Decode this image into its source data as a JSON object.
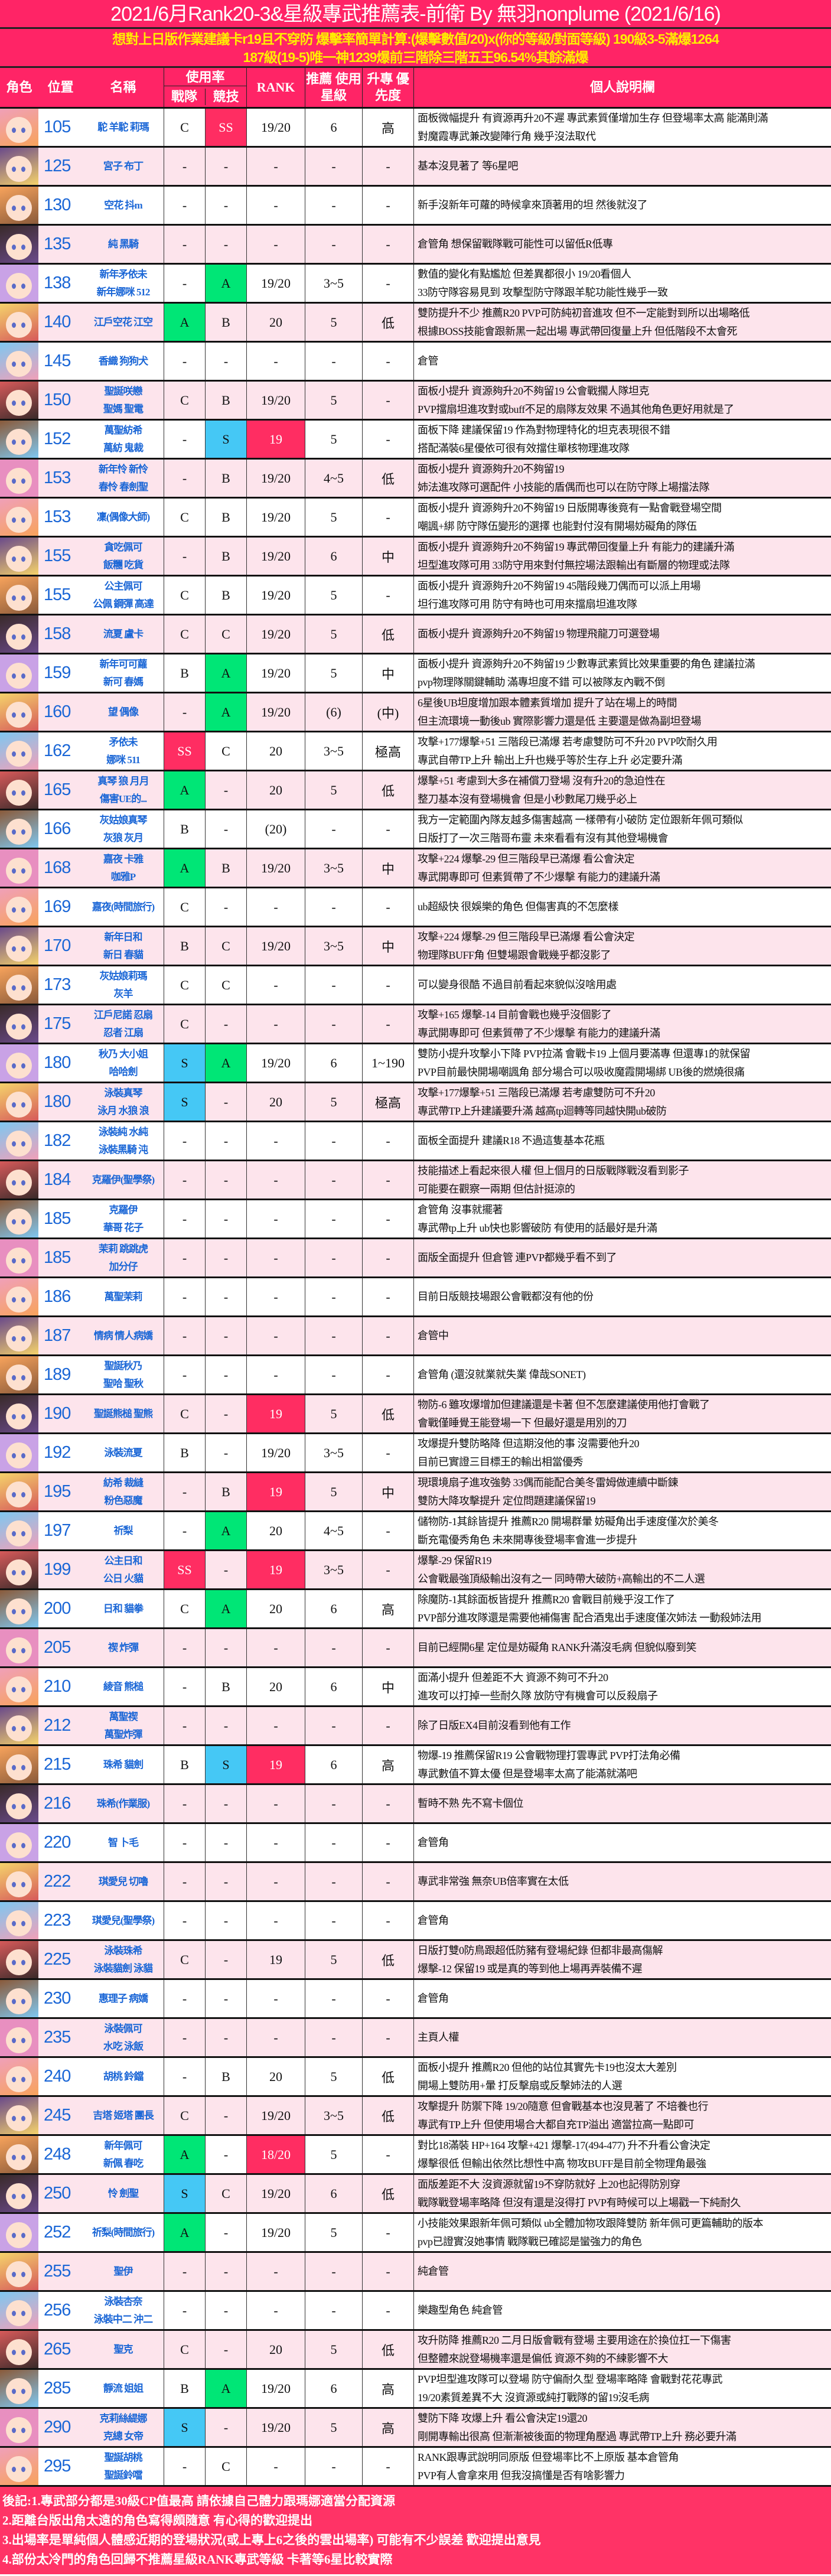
{
  "header": {
    "title": "2021/6月Rank20-3&星級專武推薦表-前衛 By 無羽nonplume (2021/6/16)",
    "subtitle_lines": [
      "想對上日版作業建議卡r19且不穿防 爆擊率簡單計算:(爆擊數值/20)x(你的等級/對面等級) 190級3-5滿爆1264",
      "187級(19-5)唯一神1239爆前三階除三階五王96.54%其餘滿爆"
    ]
  },
  "columns": {
    "character": "角色",
    "position": "位置",
    "name": "名稱",
    "usage": "使用率",
    "team": "戰隊",
    "arena": "競技",
    "rank": "RANK",
    "star": "推薦 使用星級",
    "priority": "升專 優先度",
    "notes": "個人說明欄"
  },
  "colors": {
    "header_bg": "#ff2466",
    "subtitle_text": "#ffee00",
    "row_alt": "#fde4ec",
    "SS": "#ff2d62",
    "S": "#45c8f5",
    "A": "#00e676",
    "rank_highlight": "#ff2d62",
    "name_text": "#1a66d6"
  },
  "rows": [
    {
      "no": "105",
      "name": [
        "駝 羊駝 莉瑪"
      ],
      "team": "C",
      "arena": "SS",
      "rank": "19/20",
      "star": "6",
      "priority": "高",
      "notes": [
        "面板微幅提升 有資源再升20不遲 專武素質僅增加生存 但登場率太高 能滿則滿",
        "對魔霞專武兼改變陣行角 幾乎沒法取代"
      ]
    },
    {
      "no": "125",
      "name": [
        "宮子 布丁"
      ],
      "team": "-",
      "arena": "-",
      "rank": "-",
      "star": "-",
      "priority": "-",
      "notes": [
        "基本沒見著了 等6星吧"
      ]
    },
    {
      "no": "130",
      "name": [
        "空花 抖m"
      ],
      "team": "-",
      "arena": "-",
      "rank": "-",
      "star": "-",
      "priority": "-",
      "notes": [
        "新手沒新年可蘿的時候拿來頂著用的坦 然後就沒了"
      ]
    },
    {
      "no": "135",
      "name": [
        "純 黑騎"
      ],
      "team": "-",
      "arena": "-",
      "rank": "-",
      "star": "-",
      "priority": "-",
      "notes": [
        "倉管角 想保留戰隊戰可能性可以留低R低專"
      ]
    },
    {
      "no": "138",
      "name": [
        "新年矛依未",
        "新年娜咪 512"
      ],
      "team": "-",
      "arena": "A",
      "rank": "19/20",
      "star": "3~5",
      "priority": "-",
      "notes": [
        "數值的變化有點尷尬 但差異都很小 19/20看個人",
        "33防守隊容易見到 攻擊型防守隊跟羊駝功能性幾乎一致"
      ]
    },
    {
      "no": "140",
      "name": [
        "江戶空花 江空"
      ],
      "team": "A",
      "arena": "B",
      "rank": "20",
      "star": "5",
      "priority": "低",
      "notes": [
        "雙防提升不少 推薦R20 PVP可防純初音進攻 但不一定能對到所以出場略低",
        "根據BOSS技能會跟新黑一起出場 專武帶回復量上升 但低階段不太會死"
      ]
    },
    {
      "no": "145",
      "name": [
        "香織 狗狗犬"
      ],
      "team": "-",
      "arena": "-",
      "rank": "-",
      "star": "-",
      "priority": "-",
      "notes": [
        "倉管"
      ]
    },
    {
      "no": "150",
      "name": [
        "聖誕咲戀",
        "聖媽 聖電"
      ],
      "team": "C",
      "arena": "B",
      "rank": "19/20",
      "star": "5",
      "priority": "-",
      "notes": [
        "面板小提升 資源夠升20不夠留19 公會戰擱人隊坦克",
        "PVP擋扇坦進攻對或buff不足的扇隊友效果 不過其他角色更好用就是了"
      ]
    },
    {
      "no": "152",
      "name": [
        "萬聖紡希",
        "萬紡 鬼裁"
      ],
      "team": "-",
      "arena": "S",
      "rank": "19",
      "rank_hl": true,
      "star": "5",
      "priority": "-",
      "notes": [
        "面板下降 建議保留19 作為對物理特化的坦克表現很不錯",
        "搭配滿裝6星優依可很有效擋住單核物理進攻隊"
      ]
    },
    {
      "no": "153",
      "name": [
        "新年怜 新怜",
        "春怜 春劍聖"
      ],
      "team": "-",
      "arena": "B",
      "rank": "19/20",
      "star": "4~5",
      "priority": "低",
      "notes": [
        "面板小提升 資源夠升20不夠留19",
        "姉法進攻隊可選配件 小技能的盾偶而也可以在防守隊上場擋法隊"
      ]
    },
    {
      "no": "153",
      "name": [
        "凜(偶像大師)"
      ],
      "team": "C",
      "arena": "B",
      "rank": "19/20",
      "star": "5",
      "priority": "-",
      "notes": [
        "面板小提升 資源夠升20不夠留19 日版開專後竟有一點會戰登場空間",
        "嘲諷+綁 防守隊伍變形的選擇 也能對付沒有開場妨礙角的隊伍"
      ]
    },
    {
      "no": "155",
      "name": [
        "貪吃佩可",
        "飯糰 吃貨"
      ],
      "team": "-",
      "arena": "B",
      "rank": "19/20",
      "star": "6",
      "priority": "中",
      "notes": [
        "面板小提升 資源夠升20不夠留19 專武帶回復量上升 有能力的建議升滿",
        "坦型進攻隊可用 33防守用來對付無控場法跟輸出有斷層的物理或法隊"
      ]
    },
    {
      "no": "155",
      "name": [
        "公主佩可",
        "公佩 鋼彈 高達"
      ],
      "team": "C",
      "arena": "B",
      "rank": "19/20",
      "star": "5",
      "priority": "-",
      "notes": [
        "面板小提升 資源夠升20不夠留19 45階段幾刀偶而可以派上用場",
        "坦行進攻隊可用 防守有時也可用來擋扇坦進攻隊"
      ]
    },
    {
      "no": "158",
      "name": [
        "流夏 盧卡"
      ],
      "team": "C",
      "arena": "C",
      "rank": "19/20",
      "star": "5",
      "priority": "低",
      "notes": [
        "面板小提升 資源夠升20不夠留19 物理飛龍刀可選登場"
      ]
    },
    {
      "no": "159",
      "name": [
        "新年可可蘿",
        "新可 春媽"
      ],
      "team": "B",
      "arena": "A",
      "rank": "19/20",
      "star": "5",
      "priority": "中",
      "notes": [
        "面板小提升 資源夠升20不夠留19 少數專武素質比效果重要的角色 建議拉滿",
        "pvp物理隊關鍵輔助 滿專坦度不錯 可以被隊友內戰不倒"
      ]
    },
    {
      "no": "160",
      "name": [
        "望 偶像"
      ],
      "team": "-",
      "arena": "A",
      "rank": "19/20",
      "star": "(6)",
      "priority": "(中)",
      "notes": [
        "6星後UB坦度增加跟本體素質增加 提升了站在場上的時間",
        "但主流環境一動後ub 實際影響力還是低 主要還是做為副坦登場"
      ]
    },
    {
      "no": "162",
      "name": [
        "矛依未",
        "娜咪 511"
      ],
      "team": "SS",
      "arena": "C",
      "rank": "20",
      "star": "3~5",
      "priority": "極高",
      "notes": [
        "攻擊+177爆擊+51 三階段已滿爆 若考慮雙防可不升20 PVP吹耐久用",
        "專武自帶TP上升 輸出上升也幾乎等於生存上升 必定要升滿"
      ]
    },
    {
      "no": "165",
      "name": [
        "真琴 狼 月月",
        "傷害UE的..."
      ],
      "team": "A",
      "arena": "-",
      "rank": "20",
      "star": "5",
      "priority": "低",
      "notes": [
        "爆擊+51 考慮到大多在補償刀登場 沒有升20的急迫性在",
        "整刀基本沒有登場機會 但是小秒數尾刀幾乎必上"
      ]
    },
    {
      "no": "166",
      "name": [
        "灰姑娘真琴",
        "灰狼 灰月"
      ],
      "team": "B",
      "arena": "-",
      "rank": "(20)",
      "star": "-",
      "priority": "-",
      "notes": [
        "我方一定範圍內隊友越多傷害越高 一樣帶有小破防 定位跟新年佩可類似",
        "日版打了一次三階哥布靈 未來看看有沒有其他登場機會"
      ]
    },
    {
      "no": "168",
      "name": [
        "嘉夜 卡雅",
        "咖雅P"
      ],
      "team": "A",
      "arena": "B",
      "rank": "19/20",
      "star": "3~5",
      "priority": "中",
      "notes": [
        "攻擊+224 爆擊-29 但三階段早已滿爆 看公會決定",
        "專武開專即可 但素質帶了不少爆擊 有能力的建議升滿"
      ]
    },
    {
      "no": "169",
      "name": [
        "嘉夜(時間旅行)"
      ],
      "team": "C",
      "arena": "-",
      "rank": "-",
      "star": "-",
      "priority": "-",
      "notes": [
        "ub超級快 很娛樂的角色 但傷害真的不怎麼樣"
      ]
    },
    {
      "no": "170",
      "name": [
        "新年日和",
        "新日 春貓"
      ],
      "team": "B",
      "arena": "C",
      "rank": "19/20",
      "star": "3~5",
      "priority": "中",
      "notes": [
        "攻擊+224 爆擊-29 但三階段早已滿爆 看公會決定",
        "物理隊BUFF角 但雙場跟會戰幾乎都沒影了"
      ]
    },
    {
      "no": "173",
      "name": [
        "灰姑娘莉瑪",
        "灰羊"
      ],
      "team": "C",
      "arena": "C",
      "rank": "-",
      "star": "-",
      "priority": "-",
      "notes": [
        "可以變身很酷 不過目前看起來貌似沒啥用處"
      ]
    },
    {
      "no": "175",
      "name": [
        "江戶尼諾 忍扇",
        "忍者 江扇"
      ],
      "team": "C",
      "arena": "-",
      "rank": "-",
      "star": "-",
      "priority": "-",
      "notes": [
        "攻擊+165 爆擊-14 目前會戰也幾乎沒個影了",
        "專武開專即可 但素質帶了不少爆擊 有能力的建議升滿"
      ]
    },
    {
      "no": "180",
      "name": [
        "秋乃 大小姐",
        "哈哈劍"
      ],
      "team": "S",
      "arena": "A",
      "rank": "19/20",
      "star": "6",
      "priority": "1~190",
      "notes": [
        "雙防小提升攻擊小下降 PVP拉滿 會戰卡19 上個月要滿專 但還專1的就保留",
        "PVP目前最快開場嘲諷角 部分場合可以吸收魔霞開場綁 UB後的燃燒很痛"
      ]
    },
    {
      "no": "180",
      "name": [
        "泳裝真琴",
        "泳月 水狼 浪"
      ],
      "team": "S",
      "arena": "-",
      "rank": "20",
      "star": "5",
      "priority": "極高",
      "notes": [
        "攻擊+177爆擊+51 三階段已滿爆 若考慮雙防可不升20",
        "專武帶TP上升建議要升滿 越高tp迴轉等同越快開ub破防"
      ]
    },
    {
      "no": "182",
      "name": [
        "泳裝純 水純",
        "泳裝黑騎 沌"
      ],
      "team": "-",
      "arena": "-",
      "rank": "-",
      "star": "-",
      "priority": "-",
      "notes": [
        "面板全面提升 建議R18 不過這隻基本花瓶"
      ]
    },
    {
      "no": "184",
      "name": [
        "克羅伊(聖學祭)"
      ],
      "team": "-",
      "arena": "-",
      "rank": "-",
      "star": "-",
      "priority": "-",
      "notes": [
        "技能描述上看起來很人權 但上個月的日版戰隊戰沒看到影子",
        "可能要在觀察一兩期 但估計挺涼的"
      ]
    },
    {
      "no": "185",
      "name": [
        "克羅伊",
        "華哥 花子"
      ],
      "team": "-",
      "arena": "-",
      "rank": "-",
      "star": "-",
      "priority": "-",
      "notes": [
        "倉管角 沒事就擺著",
        "專武帶tp上升 ub快也影響破防 有使用的話最好是升滿"
      ]
    },
    {
      "no": "185",
      "name": [
        "茉莉 跳跳虎",
        "加分仔"
      ],
      "team": "-",
      "arena": "-",
      "rank": "-",
      "star": "-",
      "priority": "-",
      "notes": [
        "面版全面提升 但倉管 連PVP都幾乎看不到了"
      ]
    },
    {
      "no": "186",
      "name": [
        "萬聖茉莉"
      ],
      "team": "-",
      "arena": "-",
      "rank": "-",
      "star": "-",
      "priority": "-",
      "notes": [
        "目前日版競技場跟公會戰都沒有他的份"
      ]
    },
    {
      "no": "187",
      "name": [
        "情病 情人病嬌"
      ],
      "team": "-",
      "arena": "-",
      "rank": "-",
      "star": "-",
      "priority": "-",
      "notes": [
        "倉管中"
      ]
    },
    {
      "no": "189",
      "name": [
        "聖誕秋乃",
        "聖哈 聖秋"
      ],
      "team": "-",
      "arena": "-",
      "rank": "-",
      "star": "-",
      "priority": "-",
      "notes": [
        "倉管角 (還沒就業就失業 偉哉SONET)"
      ]
    },
    {
      "no": "190",
      "name": [
        "聖誕熊槌 聖熊"
      ],
      "team": "C",
      "arena": "-",
      "rank": "19",
      "rank_hl": true,
      "star": "5",
      "priority": "低",
      "notes": [
        "物防-6 雖攻爆增加但建議還是卡著 但不怎麼建議使用他打會戰了",
        "會戰僅睡覺王能登場一下 但最好還是用別的刀"
      ]
    },
    {
      "no": "192",
      "name": [
        "泳裝流夏"
      ],
      "team": "B",
      "arena": "-",
      "rank": "19/20",
      "star": "3~5",
      "priority": "-",
      "notes": [
        "攻爆提升雙防略降 但這期沒他的事 沒需要他升20",
        "目前已實證三目標王的輸出相當優秀"
      ]
    },
    {
      "no": "195",
      "name": [
        "紡希 裁縫",
        "粉色惡魔"
      ],
      "team": "-",
      "arena": "B",
      "rank": "19",
      "rank_hl": true,
      "star": "5",
      "priority": "中",
      "notes": [
        "現環境扇子進攻強勢 33偶而能配合美冬雷姆做連續中斷鍊",
        "雙防大降攻擊提升 定位問題建議保留19"
      ]
    },
    {
      "no": "197",
      "name": [
        "祈梨"
      ],
      "team": "-",
      "arena": "A",
      "rank": "20",
      "star": "4~5",
      "priority": "-",
      "notes": [
        "儲物防-1其餘皆提升 推薦R20 開場群暈 妨礙角出手速度僅次於美冬",
        "斷充電優秀角色 未來開專後登場率會進一步提升"
      ]
    },
    {
      "no": "199",
      "name": [
        "公主日和",
        "公日 火貓"
      ],
      "team": "SS",
      "arena": "-",
      "rank": "19",
      "rank_hl": true,
      "star": "3~5",
      "priority": "-",
      "notes": [
        "爆擊-29 保留R19",
        "公會戰最強頂級輸出沒有之一 同時帶大破防+高輸出的不二人選"
      ]
    },
    {
      "no": "200",
      "name": [
        "日和 貓拳"
      ],
      "team": "C",
      "arena": "A",
      "rank": "20",
      "star": "6",
      "priority": "高",
      "notes": [
        "除魔防-1其餘面板皆提升 推薦R20 會戰目前幾乎沒工作了",
        "PVP部分進攻隊還是需要他補傷害 配合酒鬼出手速度僅次姉法 一動殺姉法用"
      ]
    },
    {
      "no": "205",
      "name": [
        "禊 炸彈"
      ],
      "team": "-",
      "arena": "-",
      "rank": "-",
      "star": "-",
      "priority": "-",
      "notes": [
        "目前已經開6星 定位是妨礙角 RANK升滿沒毛病 但貌似廢到笑"
      ]
    },
    {
      "no": "210",
      "name": [
        "綾音 熊槌"
      ],
      "team": "-",
      "arena": "B",
      "rank": "20",
      "star": "6",
      "priority": "中",
      "notes": [
        "面滿小提升 但差距不大 資源不夠可不升20",
        "進攻可以打掉一些耐久隊 放防守有機會可以反殺扇子"
      ]
    },
    {
      "no": "212",
      "name": [
        "萬聖禊",
        "萬聖炸彈"
      ],
      "team": "-",
      "arena": "-",
      "rank": "-",
      "star": "-",
      "priority": "-",
      "notes": [
        "除了日版EX4目前沒看到他有工作"
      ]
    },
    {
      "no": "215",
      "name": [
        "珠希 貓劍"
      ],
      "team": "B",
      "arena": "S",
      "rank": "19",
      "rank_hl": true,
      "star": "6",
      "priority": "高",
      "notes": [
        "物爆-19 推薦保留R19 公會戰物理打雲專武 PVP打法角必備",
        "專武數值不算太優 但是登場率太高了能滿就滿吧"
      ]
    },
    {
      "no": "216",
      "name": [
        "珠希(作業服)"
      ],
      "team": "-",
      "arena": "-",
      "rank": "-",
      "star": "-",
      "priority": "-",
      "notes": [
        "暫時不熟 先不寫卡個位"
      ]
    },
    {
      "no": "220",
      "name": [
        "智 卜毛"
      ],
      "team": "-",
      "arena": "-",
      "rank": "-",
      "star": "-",
      "priority": "-",
      "notes": [
        "倉管角"
      ]
    },
    {
      "no": "222",
      "name": [
        "琪愛兒 切嚕"
      ],
      "team": "-",
      "arena": "-",
      "rank": "-",
      "star": "-",
      "priority": "-",
      "notes": [
        "專武非常強 無奈UB倍率實在太低"
      ]
    },
    {
      "no": "223",
      "name": [
        "琪愛兒(聖學祭)"
      ],
      "team": "-",
      "arena": "-",
      "rank": "-",
      "star": "-",
      "priority": "-",
      "notes": [
        "倉管角"
      ]
    },
    {
      "no": "225",
      "name": [
        "泳裝珠希",
        "泳裝貓劍 泳貓"
      ],
      "team": "C",
      "arena": "-",
      "rank": "19",
      "star": "5",
      "priority": "低",
      "notes": [
        "日版打雙0防鳥跟超低防豬有登場紀錄 但都非最高傷解",
        "爆擊-12 保留19 或是真的等到他上場再弄裝備不遲"
      ]
    },
    {
      "no": "230",
      "name": [
        "惠理子 病嬌"
      ],
      "team": "-",
      "arena": "-",
      "rank": "-",
      "star": "-",
      "priority": "-",
      "notes": [
        "倉管角"
      ]
    },
    {
      "no": "235",
      "name": [
        "泳裝佩可",
        "水吃 泳飯"
      ],
      "team": "-",
      "arena": "-",
      "rank": "-",
      "star": "-",
      "priority": "-",
      "notes": [
        "主頁人權"
      ]
    },
    {
      "no": "240",
      "name": [
        "胡桃 鈴鐺"
      ],
      "team": "-",
      "arena": "B",
      "rank": "20",
      "star": "5",
      "priority": "低",
      "notes": [
        "面板小提升 推薦R20 但他的站位其實先卡19也沒太大差別",
        "開場上雙防用+暈 打反擊扇或反擊姉法的人選"
      ]
    },
    {
      "no": "245",
      "name": [
        "吉塔 姬塔 團長"
      ],
      "team": "C",
      "arena": "-",
      "rank": "19/20",
      "star": "3~5",
      "priority": "低",
      "notes": [
        "攻擊提升 防禦下降 19/20隨意 但會戰基本也沒見著了 不培養也行",
        "專武有TP上升 但使用場合大都自充TP溢出 適當拉高一點即可"
      ]
    },
    {
      "no": "248",
      "name": [
        "新年佩可",
        "新佩 春吃"
      ],
      "team": "A",
      "arena": "-",
      "rank": "18/20",
      "rank_hl": true,
      "star": "5",
      "priority": "-",
      "notes": [
        "對比18滿裝 HP+164 攻擊+421 爆擊-17(494-477) 升不升看公會決定",
        "爆擊很低 但輸出依然比想性中高 物攻BUFF是目前全物理角最強"
      ]
    },
    {
      "no": "250",
      "name": [
        "怜 劍聖"
      ],
      "team": "S",
      "arena": "C",
      "rank": "19/20",
      "star": "6",
      "priority": "低",
      "notes": [
        "面版差距不大 沒資源就留19不穿防就好 上20也記得防別穿",
        "戰隊戰登場率略降 但沒有還是沒得打 PVP有時候可以上場戳一下純耐久"
      ]
    },
    {
      "no": "252",
      "name": [
        "祈梨(時間旅行)"
      ],
      "team": "A",
      "arena": "-",
      "rank": "19/20",
      "star": "5",
      "priority": "-",
      "notes": [
        "小技能效果跟新年佩可類似 ub全體加物攻跟降雙防 新年佩可更篇輔助的版本",
        "pvp已證實沒她事情 戰隊戰已確認是蠻強力的角色"
      ]
    },
    {
      "no": "255",
      "name": [
        "聖伊"
      ],
      "team": "-",
      "arena": "-",
      "rank": "-",
      "star": "-",
      "priority": "-",
      "notes": [
        "純倉管"
      ]
    },
    {
      "no": "256",
      "name": [
        "泳裝杏奈",
        "泳裝中二 沖二"
      ],
      "team": "-",
      "arena": "-",
      "rank": "-",
      "star": "-",
      "priority": "-",
      "notes": [
        "樂趣型角色 純倉管"
      ]
    },
    {
      "no": "265",
      "name": [
        "聖克"
      ],
      "team": "C",
      "arena": "-",
      "rank": "20",
      "star": "5",
      "priority": "低",
      "notes": [
        "攻升防降 推薦R20 二月日版會戰有登場 主要用途在於換位扛一下傷害",
        "但整體來說登場機率還是偏低 資源不夠的不練影響不大"
      ]
    },
    {
      "no": "285",
      "name": [
        "靜流 姐姐"
      ],
      "team": "B",
      "arena": "A",
      "rank": "19/20",
      "star": "6",
      "priority": "高",
      "notes": [
        "PVP坦型進攻隊可以登場 防守偏耐久型 登場率略降 會戰對花花專武",
        "19/20素質差異不大 沒資源或純打戰隊的留19沒毛病"
      ]
    },
    {
      "no": "290",
      "name": [
        "克莉絲緹娜",
        "克總 女帝"
      ],
      "team": "S",
      "arena": "-",
      "rank": "19/20",
      "star": "5",
      "priority": "高",
      "notes": [
        "雙防下降 攻爆上升 看公會決定19還20",
        "剛開專輸出很高 但漸漸被後面的物理角壓過 專武帶TP上升 務必要升滿"
      ]
    },
    {
      "no": "295",
      "name": [
        "聖誕胡桃",
        "聖誕鈴噹"
      ],
      "team": "-",
      "arena": "C",
      "rank": "-",
      "star": "-",
      "priority": "-",
      "notes": [
        "RANK跟專武說明同原版 但登場率比不上原版 基本倉管角",
        "PVP有人會拿來用 但我沒搞懂是否有啥影響力"
      ]
    }
  ],
  "footer": [
    "後記:1.專武部分都是30級CP值最高 請依據自己體力跟瑪娜適當分配資源",
    "2.距離台版出角太遠的角色寫得頗隨意 有心得的歡迎提出",
    "3.出場率是單純個人體感近期的登場狀況(或上專上6之後的雲出場率) 可能有不少誤差 歡迎提出意見",
    "4.部份太冷門的角色回歸不推薦星級RANK專武等級 卡著等6星比較實際"
  ]
}
